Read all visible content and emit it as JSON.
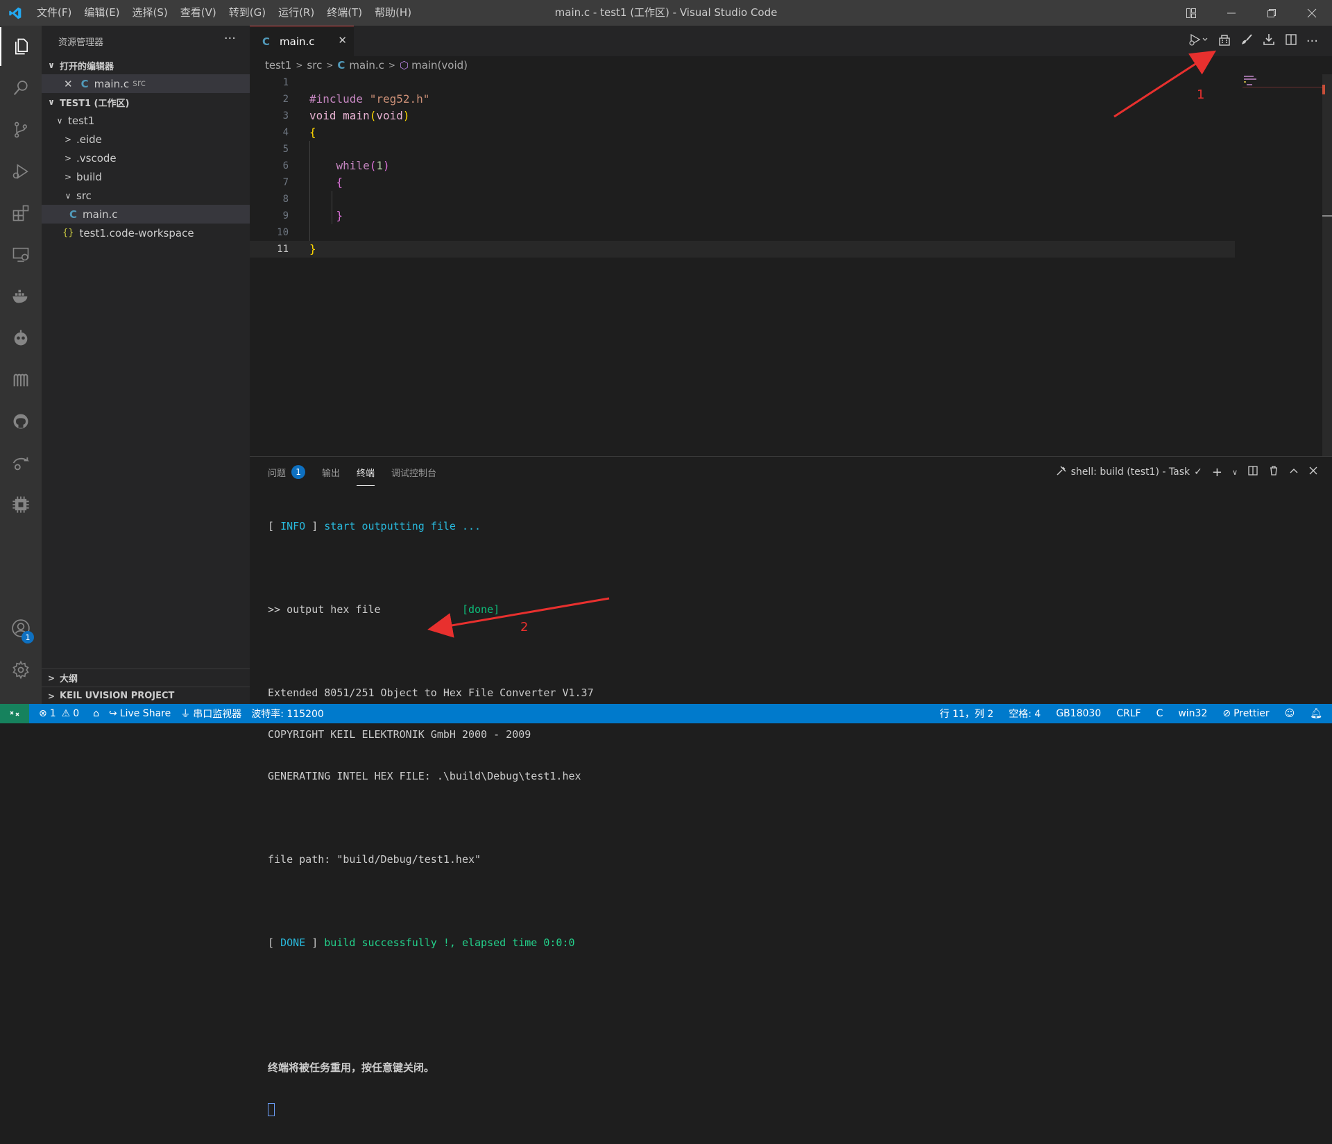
{
  "window": {
    "title": "main.c - test1 (工作区) - Visual Studio Code",
    "menu": [
      "文件(F)",
      "编辑(E)",
      "选择(S)",
      "查看(V)",
      "转到(G)",
      "运行(R)",
      "终端(T)",
      "帮助(H)"
    ]
  },
  "activity": {
    "accounts_badge": "1"
  },
  "sidebar": {
    "title": "资源管理器",
    "open_editors_label": "打开的编辑器",
    "open_editor": {
      "name": "main.c",
      "desc": "src"
    },
    "workspace_label": "TEST1 (工作区)",
    "tree": {
      "root": "test1",
      "eide": ".eide",
      "vscode": ".vscode",
      "build": "build",
      "src": "src",
      "mainc": "main.c",
      "workspace_file": "test1.code-workspace"
    },
    "outline_label": "大纲",
    "keil_label": "KEIL UVISION PROJECT"
  },
  "editor": {
    "tab_label": "main.c",
    "tab_icon": "C",
    "breadcrumb": {
      "folder": "test1",
      "sub": "src",
      "file": "main.c",
      "symbol": "main(void)"
    },
    "line_numbers": [
      "1",
      "2",
      "3",
      "4",
      "5",
      "6",
      "7",
      "8",
      "9",
      "10",
      "11"
    ],
    "code": {
      "l2_kw": "#include",
      "l2_str": "\"reg52.h\"",
      "l3_kw": "void",
      "l3_fn": "main",
      "l3_arg": "void",
      "l6_kw": "while",
      "l6_num": "1"
    }
  },
  "panel": {
    "tabs": {
      "problems": "问题",
      "output": "输出",
      "terminal": "终端",
      "debug": "调试控制台"
    },
    "problems_badge": "1",
    "task_label": "shell: build (test1) - Task",
    "terminal": {
      "l1_a": "[ ",
      "l1_b": "INFO",
      "l1_c": " ] ",
      "l1_d": "start outputting file ...",
      "l2_a": ">> output hex file",
      "l2_b": "[done]",
      "l3": "Extended 8051/251 Object to Hex File Converter V1.37",
      "l4": "COPYRIGHT KEIL ELEKTRONIK GmbH 2000 - 2009",
      "l5": "GENERATING INTEL HEX FILE: .\\build\\Debug\\test1.hex",
      "l6": "file path: \"build/Debug/test1.hex\"",
      "l7_b": "DONE",
      "l7_d": "build successfully !, elapsed time 0:0:0",
      "l8": "终端将被任务重用，按任意键关闭。"
    }
  },
  "status": {
    "errors": "1",
    "warnings": "0",
    "live_share": "Live Share",
    "serial_monitor": "串口监视器",
    "baud": "波特率: 115200",
    "position": "行 11，列 2",
    "spaces": "空格: 4",
    "encoding": "GB18030",
    "eol": "CRLF",
    "language": "C",
    "platform": "win32",
    "prettier": "Prettier"
  },
  "annotations": {
    "label_1": "1",
    "label_2": "2",
    "color": "#e8302e"
  }
}
